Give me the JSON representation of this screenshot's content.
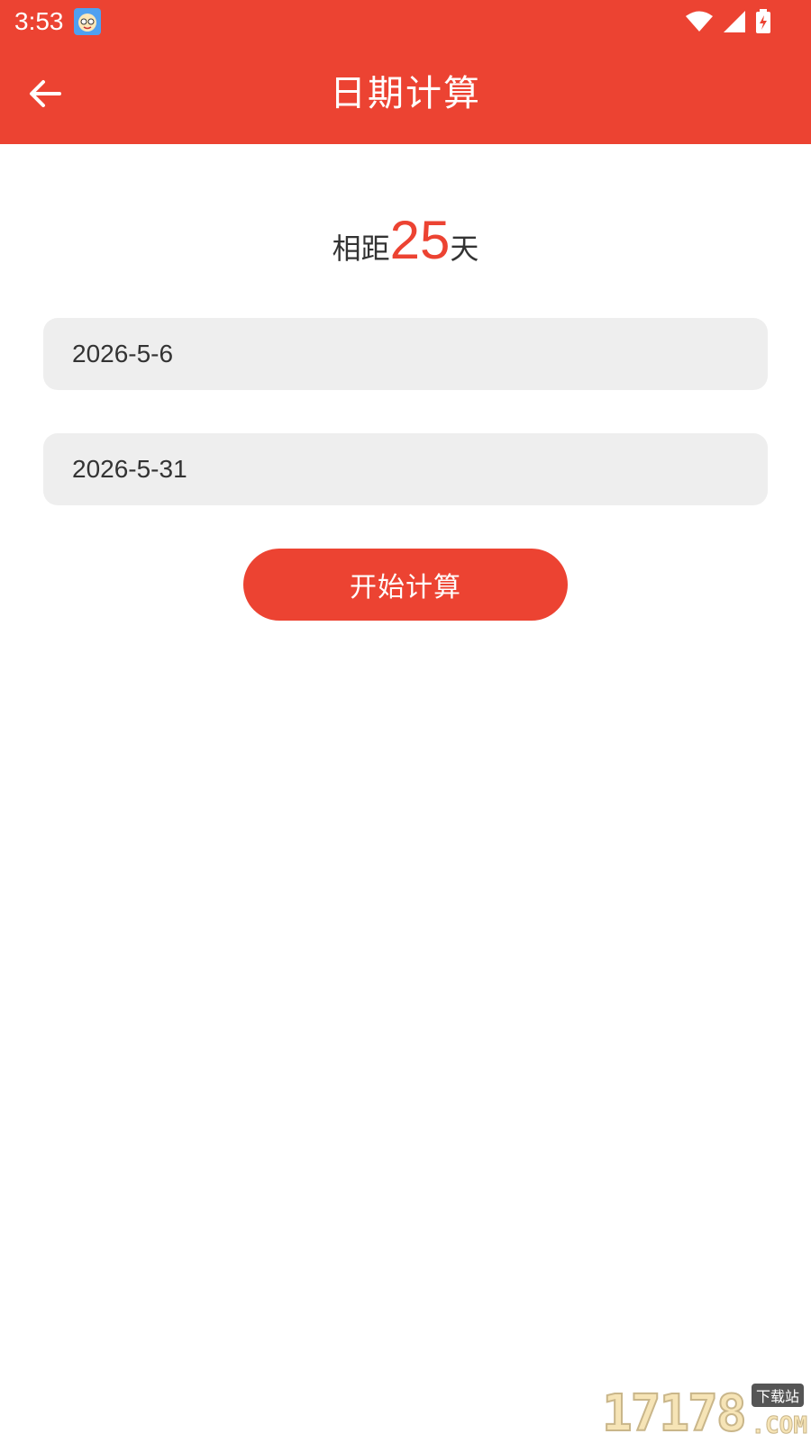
{
  "status_bar": {
    "time": "3:53",
    "app_icon": "app-face-icon",
    "icons": [
      "wifi-icon",
      "signal-icon",
      "battery-charging-icon"
    ]
  },
  "app_bar": {
    "title": "日期计算",
    "back_icon": "back-arrow-icon"
  },
  "result": {
    "prefix": "相距",
    "days": "25",
    "suffix": "天"
  },
  "form": {
    "start_date": "2026-5-6",
    "end_date": "2026-5-31",
    "calculate_label": "开始计算"
  },
  "watermark": {
    "digits": "17178",
    "badge": "下载站",
    "suffix": ".COM"
  },
  "colors": {
    "accent": "#EC4332",
    "field_bg": "#EEEEEE",
    "text": "#333333"
  }
}
